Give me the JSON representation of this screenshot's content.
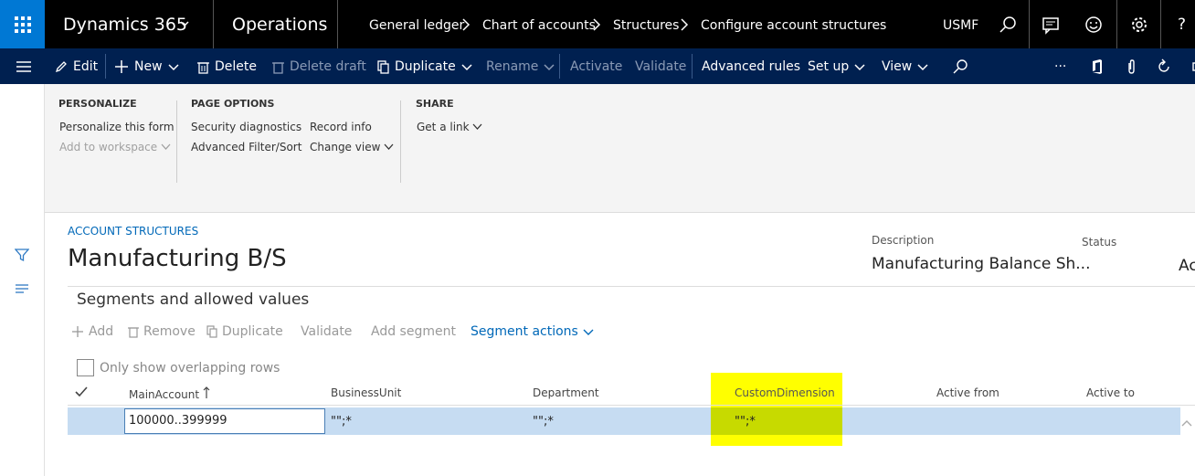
{
  "topbar": {
    "app_name": "Dynamics 365",
    "module": "Operations",
    "breadcrumbs": [
      "General ledger",
      "Chart of accounts",
      "Structures",
      "Configure account structures"
    ],
    "company": "USMF",
    "help": "?"
  },
  "actionbar": {
    "edit": "Edit",
    "new": "New",
    "delete": "Delete",
    "delete_draft": "Delete draft",
    "duplicate": "Duplicate",
    "rename": "Rename",
    "activate": "Activate",
    "validate": "Validate",
    "advanced_rules": "Advanced rules",
    "set_up": "Set up",
    "view": "View",
    "more": "···"
  },
  "ribbon": {
    "personalize": {
      "heading": "PERSONALIZE",
      "items": [
        "Personalize this form",
        "Add to workspace"
      ]
    },
    "page_options": {
      "heading": "PAGE OPTIONS",
      "items": [
        "Security diagnostics",
        "Advanced Filter/Sort",
        "Record info",
        "Change view"
      ]
    },
    "share": {
      "heading": "SHARE",
      "items": [
        "Get a link"
      ]
    }
  },
  "record": {
    "section_label": "ACCOUNT STRUCTURES",
    "title": "Manufacturing B/S",
    "description_label": "Description",
    "description_value": "Manufacturing Balance Sh...",
    "status_label": "Status",
    "status_value": "Ac"
  },
  "fasttab": {
    "title": "Segments and allowed values",
    "commands": {
      "add": "Add",
      "remove": "Remove",
      "duplicate": "Duplicate",
      "validate": "Validate",
      "add_segment": "Add segment",
      "segment_actions": "Segment actions"
    },
    "overlap_label": "Only show overlapping rows",
    "columns": [
      "MainAccount",
      "BusinessUnit",
      "Department",
      "CustomDimension",
      "Active from",
      "Active to"
    ],
    "rows": [
      {
        "main_account": "100000..399999",
        "business_unit": "\"\";*",
        "department": "\"\";*",
        "custom_dimension": "\"\";*",
        "active_from": "",
        "active_to": ""
      }
    ]
  },
  "colors": {
    "nav_bg": "#000000",
    "waffle_bg": "#0078d4",
    "action_bg": "#002050",
    "link": "#0068b8",
    "highlight": "#ffff00",
    "row_selected": "#c6dcf2"
  }
}
